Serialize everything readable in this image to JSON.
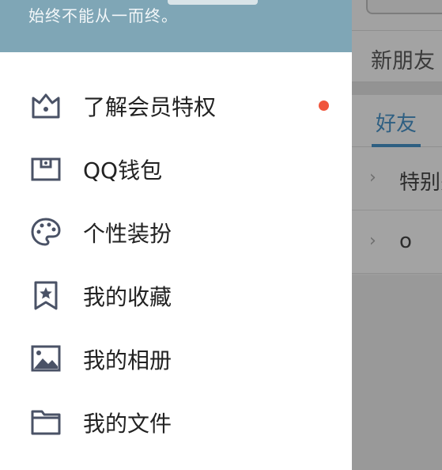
{
  "drawer": {
    "signature": "始终不能从一而终。",
    "menu": [
      {
        "label": "了解会员特权",
        "icon": "crown-icon",
        "badge": true
      },
      {
        "label": "QQ钱包",
        "icon": "wallet-icon",
        "badge": false
      },
      {
        "label": "个性装扮",
        "icon": "palette-icon",
        "badge": false
      },
      {
        "label": "我的收藏",
        "icon": "favorite-bookmark-icon",
        "badge": false
      },
      {
        "label": "我的相册",
        "icon": "photo-album-icon",
        "badge": false
      },
      {
        "label": "我的文件",
        "icon": "folder-icon",
        "badge": false
      }
    ]
  },
  "main": {
    "new_friends_label": "新朋友",
    "tabs": [
      {
        "label": "好友",
        "active": true
      }
    ],
    "groups": [
      {
        "name": "特别关心"
      },
      {
        "name": "o"
      }
    ]
  },
  "colors": {
    "header_bg": "#7fa6b6",
    "badge": "#f0553c",
    "icon_stroke": "#4a5266",
    "tab_active": "#2e5f82"
  }
}
